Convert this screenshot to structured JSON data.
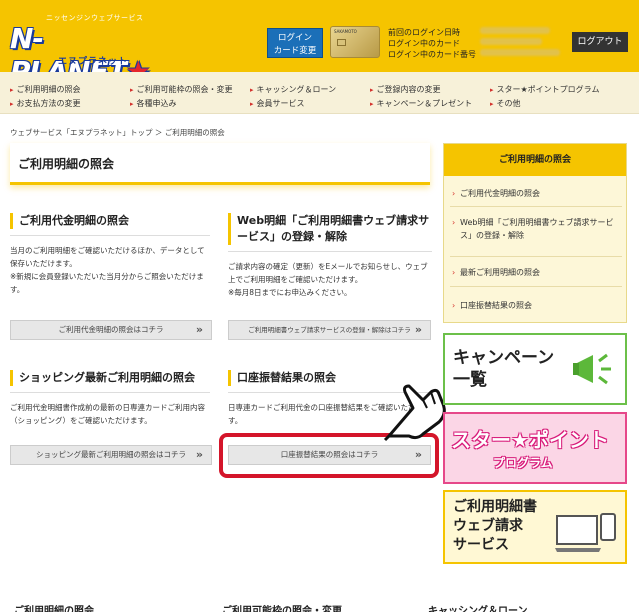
{
  "header": {
    "logo_top": "ニッセンジンウェブサービス",
    "logo_main": "N-PLANET",
    "logo_sub": "エヌプラネット",
    "login_card_change": "ログイン\nカード変更",
    "card_brand": "SAKAMOTO",
    "login_info": [
      "前回のログイン日時",
      "ログイン中のカード",
      "ログイン中のカード番号"
    ],
    "logout": "ログアウト"
  },
  "nav": {
    "items": [
      "ご利用明細の照会",
      "ご利用可能枠の照会・変更",
      "キャッシング＆ローン",
      "ご登録内容の変更",
      "スター★ポイントプログラム",
      "お支払方法の変更",
      "各種申込み",
      "会員サービス",
      "キャンペーン＆プレゼント",
      "その他"
    ]
  },
  "breadcrumb": "ウェブサービス「エヌプラネット」トップ ＞ ご利用明細の照会",
  "page_title": "ご利用明細の照会",
  "sections": [
    {
      "title": "ご利用代金明細の照会",
      "desc": "当月のご利用明細をご確認いただけるほか、データとして保存いただけます。\n※新規に会員登録いただいた当月分からご照会いただけます。",
      "button": "ご利用代金明細の照会はコチラ"
    },
    {
      "title": "Web明細「ご利用明細書ウェブ請求サービス」の登録・解除",
      "desc": "ご請求内容の確定（更新）をEメールでお知らせし、ウェブ上でご利用明細をご確認いただけます。\n※毎月8日までにお申込みください。",
      "button": "ご利用明細書ウェブ請求サービスの登録・解除はコチラ"
    },
    {
      "title": "ショッピング最新ご利用明細の照会",
      "desc": "ご利用代金明細書作成前の最新の日専連カードご利用内容（ショッピング）をご確認いただけます。",
      "button": "ショッピング最新ご利用明細の照会はコチラ"
    },
    {
      "title": "口座振替結果の照会",
      "desc": "日専連カードご利用代金の口座振替結果をご確認いただけます。",
      "button": "口座振替結果の照会はコチラ"
    }
  ],
  "sidebar": {
    "heading": "ご利用明細の照会",
    "items": [
      "ご利用代金明細の照会",
      "Web明細「ご利用明細書ウェブ請求サービス」の登録・解除",
      "最新ご利用明細の照会",
      "口座振替結果の照会"
    ]
  },
  "banners": {
    "campaign": "キャンペーン\n一覧",
    "star_top": "スター★ポイント",
    "star_bottom": "プログラム",
    "web_statement": "ご利用明細書\nウェブ請求\nサービス"
  },
  "footer_links": [
    "ご利用明細の照会",
    "ご利用可能枠の照会・変更",
    "キャッシング＆ローン"
  ],
  "colors": {
    "brand_yellow": "#f5c400",
    "highlight_red": "#d4152a",
    "button_blue": "#1b6fb8"
  }
}
